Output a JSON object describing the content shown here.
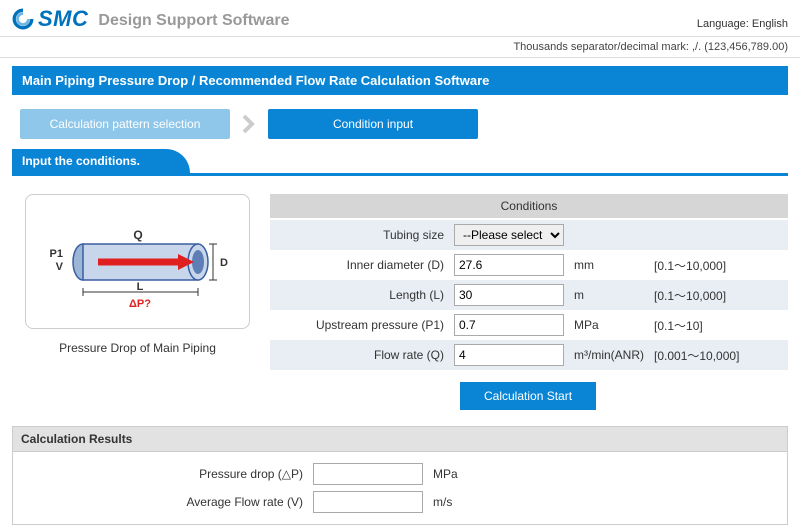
{
  "header": {
    "brand": "SMC",
    "app_title": "Design Support Software",
    "language_label": "Language: English",
    "format_note": "Thousands separator/decimal mark: ,/. (123,456,789.00)"
  },
  "main_title": "Main Piping Pressure Drop / Recommended Flow Rate Calculation Software",
  "steps": {
    "s1": "Calculation pattern selection",
    "s2": "Condition input"
  },
  "subhead": "Input the conditions.",
  "diagram": {
    "caption": "Pressure Drop of Main Piping",
    "labels": {
      "p1": "P1",
      "v": "V",
      "q": "Q",
      "d": "D",
      "l": "L",
      "dp": "ΔP?"
    }
  },
  "conditions": {
    "header": "Conditions",
    "tubing": {
      "label": "Tubing size",
      "value": "--Please select--"
    },
    "inner_d": {
      "label": "Inner diameter (D)",
      "value": "27.6",
      "unit": "mm",
      "range": "[0.1～10,000]"
    },
    "length": {
      "label": "Length (L)",
      "value": "30",
      "unit": "m",
      "range": "[0.1～10,000]"
    },
    "upstream": {
      "label": "Upstream pressure (P1)",
      "value": "0.7",
      "unit": "MPa",
      "range": "[0.1～10]"
    },
    "flow": {
      "label": "Flow rate (Q)",
      "value": "4",
      "unit": "m³/min(ANR)",
      "range": "[0.001～10,000]"
    },
    "calc_btn": "Calculation Start"
  },
  "results": {
    "header": "Calculation Results",
    "dp": {
      "label": "Pressure drop (△P)",
      "value": "",
      "unit": "MPa"
    },
    "avg": {
      "label": "Average Flow rate (V)",
      "value": "",
      "unit": "m/s"
    }
  }
}
